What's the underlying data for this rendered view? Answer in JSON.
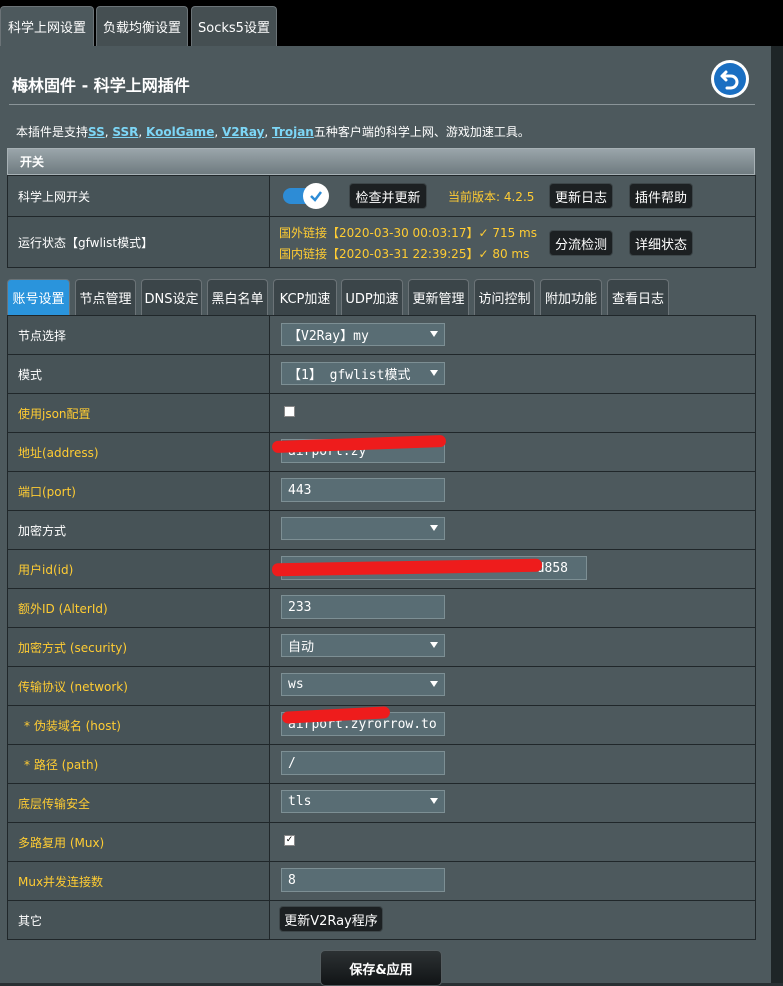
{
  "top_tabs": [
    "科学上网设置",
    "负载均衡设置",
    "Socks5设置"
  ],
  "title": "梅林固件 - 科学上网插件",
  "description": {
    "prefix": "本插件是支持",
    "links": [
      "SS",
      "SSR",
      "KoolGame",
      "V2Ray",
      "Trojan"
    ],
    "separator": ", ",
    "suffix": "五种客户端的科学上网、游戏加速工具。"
  },
  "switch_section": {
    "header": "开关",
    "switch_label": "科学上网开关",
    "switch_on": true,
    "check_update_button": "检查并更新",
    "version_text": "当前版本: 4.2.5",
    "changelog_button": "更新日志",
    "help_button": "插件帮助",
    "run_status_label": "运行状态【gfwlist模式】",
    "foreign_status": "国外链接【2020-03-30 00:03:17】✓  715 ms",
    "domestic_status": "国内链接【2020-03-31 22:39:25】✓  80 ms",
    "split_detect_button": "分流检测",
    "detail_status_button": "详细状态"
  },
  "sub_tabs": [
    "账号设置",
    "节点管理",
    "DNS设定",
    "黑白名单",
    "KCP加速",
    "UDP加速",
    "更新管理",
    "访问控制",
    "附加功能",
    "查看日志"
  ],
  "active_sub_tab": 0,
  "rows": {
    "node_select": {
      "label": "节点选择",
      "value": "【V2Ray】my"
    },
    "mode": {
      "label": "模式",
      "value": "【1】 gfwlist模式"
    },
    "use_json": {
      "label": "使用json配置",
      "checked": false
    },
    "address": {
      "label": "地址(address)",
      "value": "airport.zy"
    },
    "port": {
      "label": "端口(port)",
      "value": "443"
    },
    "encryption": {
      "label": "加密方式",
      "value": ""
    },
    "user_id": {
      "label": "用户id(id)",
      "value": "d858"
    },
    "alter_id": {
      "label": "额外ID (AlterId)",
      "value": "233"
    },
    "security": {
      "label": "加密方式 (security)",
      "value": "自动"
    },
    "network": {
      "label": "传输协议 (network)",
      "value": "ws"
    },
    "host": {
      "label": "* 伪装域名 (host)",
      "value": "airport.zyrorrow.to"
    },
    "path": {
      "label": "* 路径 (path)",
      "value": "/"
    },
    "tls": {
      "label": "底层传输安全",
      "value": "tls"
    },
    "mux": {
      "label": "多路复用 (Mux)",
      "checked": true
    },
    "mux_concurrency": {
      "label": "Mux并发连接数",
      "value": "8"
    },
    "other": {
      "label": "其它",
      "button": "更新V2Ray程序"
    }
  },
  "save_button": "保存&应用",
  "colors": {
    "panel_bg": "#4d595d",
    "label_white": "#ffffff",
    "label_yellow": "#ffcc33",
    "accent_blue": "#2a94dc",
    "redaction_red": "#ee1c1c"
  }
}
